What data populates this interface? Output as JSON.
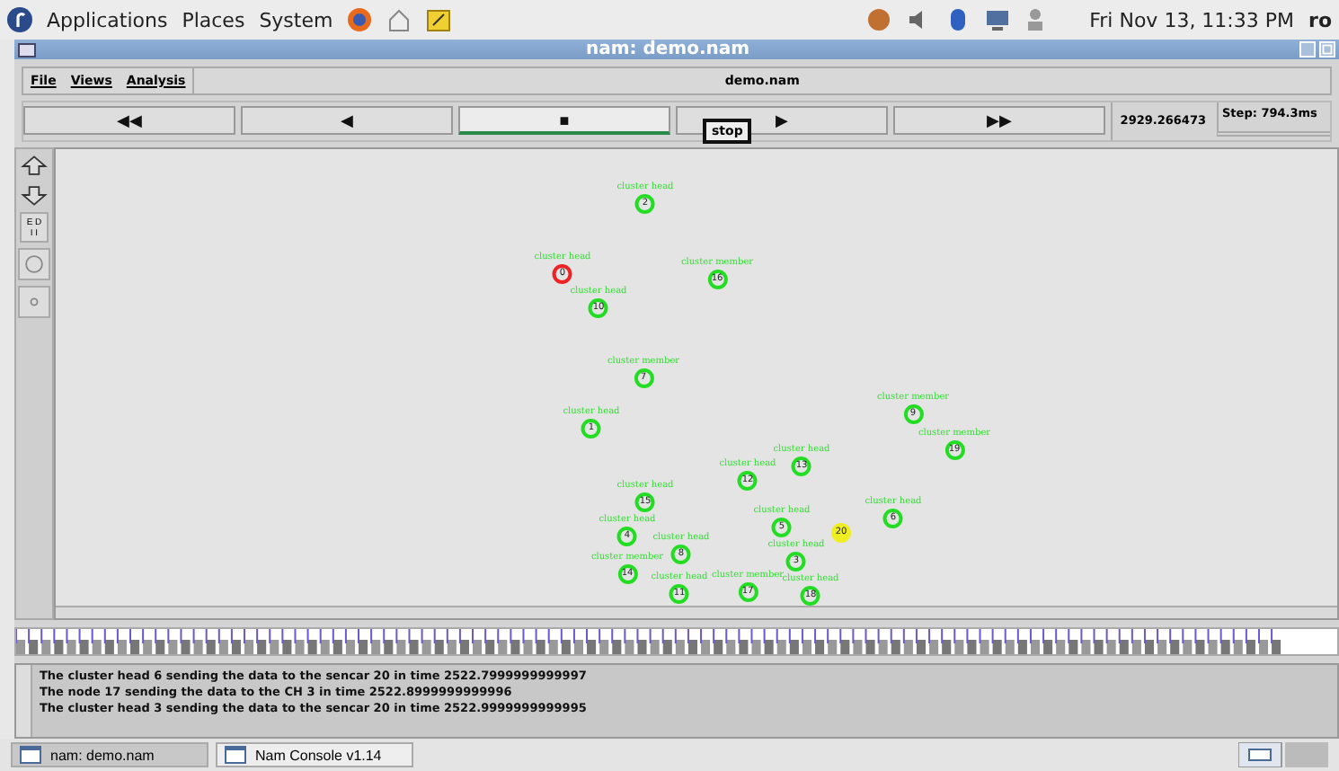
{
  "top_panel": {
    "menus": [
      "Applications",
      "Places",
      "System"
    ],
    "clock": "Fri Nov 13, 11:33 PM",
    "user": "ro"
  },
  "window": {
    "title": "nam: demo.nam"
  },
  "menu_bar": {
    "items": [
      "File",
      "Views",
      "Analysis"
    ],
    "file_label": "demo.nam"
  },
  "controls": {
    "buttons": [
      {
        "glyph": "◀◀",
        "selected": false
      },
      {
        "glyph": "◀",
        "selected": false
      },
      {
        "glyph": "■",
        "selected": true
      },
      {
        "glyph": "▶",
        "selected": false
      },
      {
        "glyph": "▶▶",
        "selected": false
      }
    ],
    "tooltip": "stop",
    "time": "2929.266473",
    "step": "Step: 794.3ms"
  },
  "tools": [
    {
      "kind": "zoom-in"
    },
    {
      "kind": "zoom-out"
    },
    {
      "kind": "ed",
      "label": "E D\nI I"
    },
    {
      "kind": "circle"
    },
    {
      "kind": "dot"
    }
  ],
  "nodes": [
    {
      "id": "2",
      "label": "cluster head",
      "color": "#22dd22"
    },
    {
      "id": "10",
      "label": "cluster head",
      "color": "#22dd22"
    },
    {
      "id": "0",
      "label": "cluster head",
      "color": "#ee2222"
    },
    {
      "id": "16",
      "label": "cluster member",
      "color": "#22dd22"
    },
    {
      "id": "7",
      "label": "cluster member",
      "color": "#22dd22"
    },
    {
      "id": "1",
      "label": "cluster head",
      "color": "#22dd22"
    },
    {
      "id": "19",
      "label": "cluster member",
      "color": "#22dd22"
    },
    {
      "id": "9",
      "label": "cluster member",
      "color": "#22dd22"
    },
    {
      "id": "12",
      "label": "cluster head",
      "color": "#22dd22"
    },
    {
      "id": "13",
      "label": "cluster head",
      "color": "#22dd22"
    },
    {
      "id": "15",
      "label": "cluster head",
      "color": "#22dd22"
    },
    {
      "id": "4",
      "label": "cluster head",
      "color": "#22dd22"
    },
    {
      "id": "5",
      "label": "cluster head",
      "color": "#22dd22"
    },
    {
      "id": "6",
      "label": "cluster head",
      "color": "#22dd22"
    },
    {
      "id": "20",
      "color": "#eeee22"
    },
    {
      "id": "8",
      "label": "cluster head",
      "color": "#22dd22"
    },
    {
      "id": "14",
      "label": "cluster member",
      "color": "#22dd22"
    },
    {
      "id": "3",
      "label": "cluster head",
      "color": "#22dd22"
    },
    {
      "id": "11",
      "label": "cluster head",
      "color": "#22dd22"
    },
    {
      "id": "17",
      "label": "cluster member",
      "color": "#22dd22"
    },
    {
      "id": "18",
      "label": "cluster head",
      "color": "#22dd22"
    }
  ],
  "console": [
    "The cluster head 6 sending the data to the sencar 20 in time 2522.7999999999997",
    "The node 17 sending the data to the CH 3 in time 2522.8999999999996",
    "The cluster head 3 sending the data to the sencar 20 in time 2522.9999999999995"
  ],
  "taskbar": [
    {
      "title": "nam: demo.nam",
      "selected": true
    },
    {
      "title": "Nam Console v1.14",
      "selected": false
    }
  ]
}
